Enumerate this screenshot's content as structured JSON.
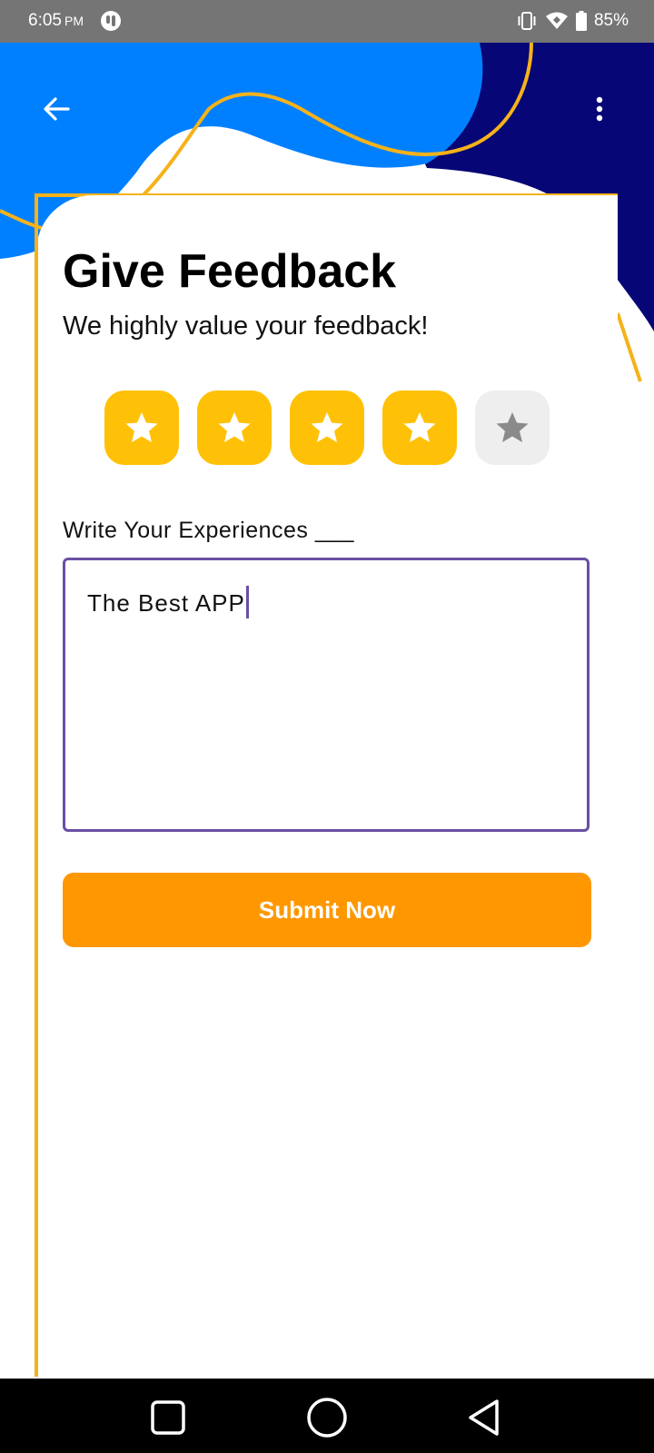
{
  "status_bar": {
    "time": "6:05",
    "ampm": "PM",
    "battery": "85%",
    "icons": [
      "notification-app-icon",
      "vibrate-icon",
      "wifi-icon",
      "battery-icon"
    ]
  },
  "header": {
    "back_icon": "arrow-back-icon",
    "menu_icon": "more-vert-icon"
  },
  "content": {
    "title": "Give Feedback",
    "subtitle": "We highly value your feedback!",
    "rating": {
      "value": 4,
      "max": 5
    },
    "experience_label": "Write Your Experiences ___",
    "experience_value": "The Best APP",
    "submit_label": "Submit Now"
  },
  "navigation": {
    "buttons": [
      "recents-square-icon",
      "home-circle-icon",
      "back-triangle-icon"
    ]
  },
  "colors": {
    "status_bar": "#757575",
    "blue": "#0080ff",
    "navy": "#060676",
    "accent_yellow": "#f5b21a",
    "star_on": "#ffc107",
    "star_off": "#eeeeee",
    "input_border": "#6a4fa3",
    "submit": "#ff9800"
  }
}
